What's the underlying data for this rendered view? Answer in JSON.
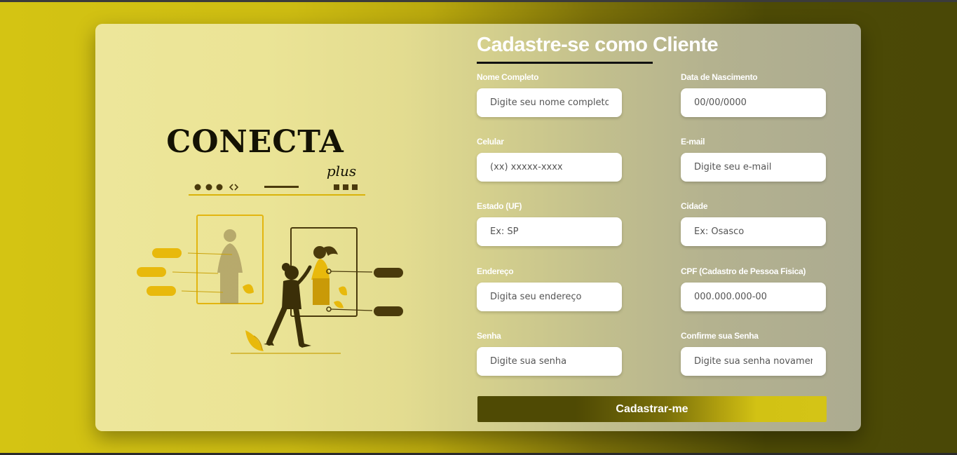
{
  "brand": {
    "logo_text": "CONECTA",
    "logo_subtext": "plus"
  },
  "form": {
    "title": "Cadastre-se como Cliente",
    "fields": [
      {
        "label": "Nome Completo",
        "placeholder": "Digite seu nome completo",
        "value": ""
      },
      {
        "label": "Data de Nascimento",
        "placeholder": "00/00/0000",
        "value": ""
      },
      {
        "label": "Celular",
        "placeholder": "(xx) xxxxx-xxxx",
        "value": ""
      },
      {
        "label": "E-mail",
        "placeholder": "Digite seu e-mail",
        "value": ""
      },
      {
        "label": "Estado (UF)",
        "placeholder": "Ex: SP",
        "value": ""
      },
      {
        "label": "Cidade",
        "placeholder": "Ex: Osasco",
        "value": ""
      },
      {
        "label": "Endereço",
        "placeholder": "Digita seu endereço",
        "value": ""
      },
      {
        "label": "CPF (Cadastro de Pessoa Fisica)",
        "placeholder": "000.000.000-00",
        "value": ""
      },
      {
        "label": "Senha",
        "placeholder": "Digite sua senha",
        "value": ""
      },
      {
        "label": "Confirme sua Senha",
        "placeholder": "Digite sua senha novamente",
        "value": ""
      }
    ],
    "submit_label": "Cadastrar-me"
  },
  "colors": {
    "accent_yellow": "#d4c413",
    "accent_olive": "#4f4a04",
    "illustration_yellow": "#e8b90c",
    "illustration_dark": "#4a3a0c"
  },
  "icons": [
    "browser-dots-icon",
    "code-brackets-icon",
    "window-squares-icon",
    "leaf-icon"
  ]
}
